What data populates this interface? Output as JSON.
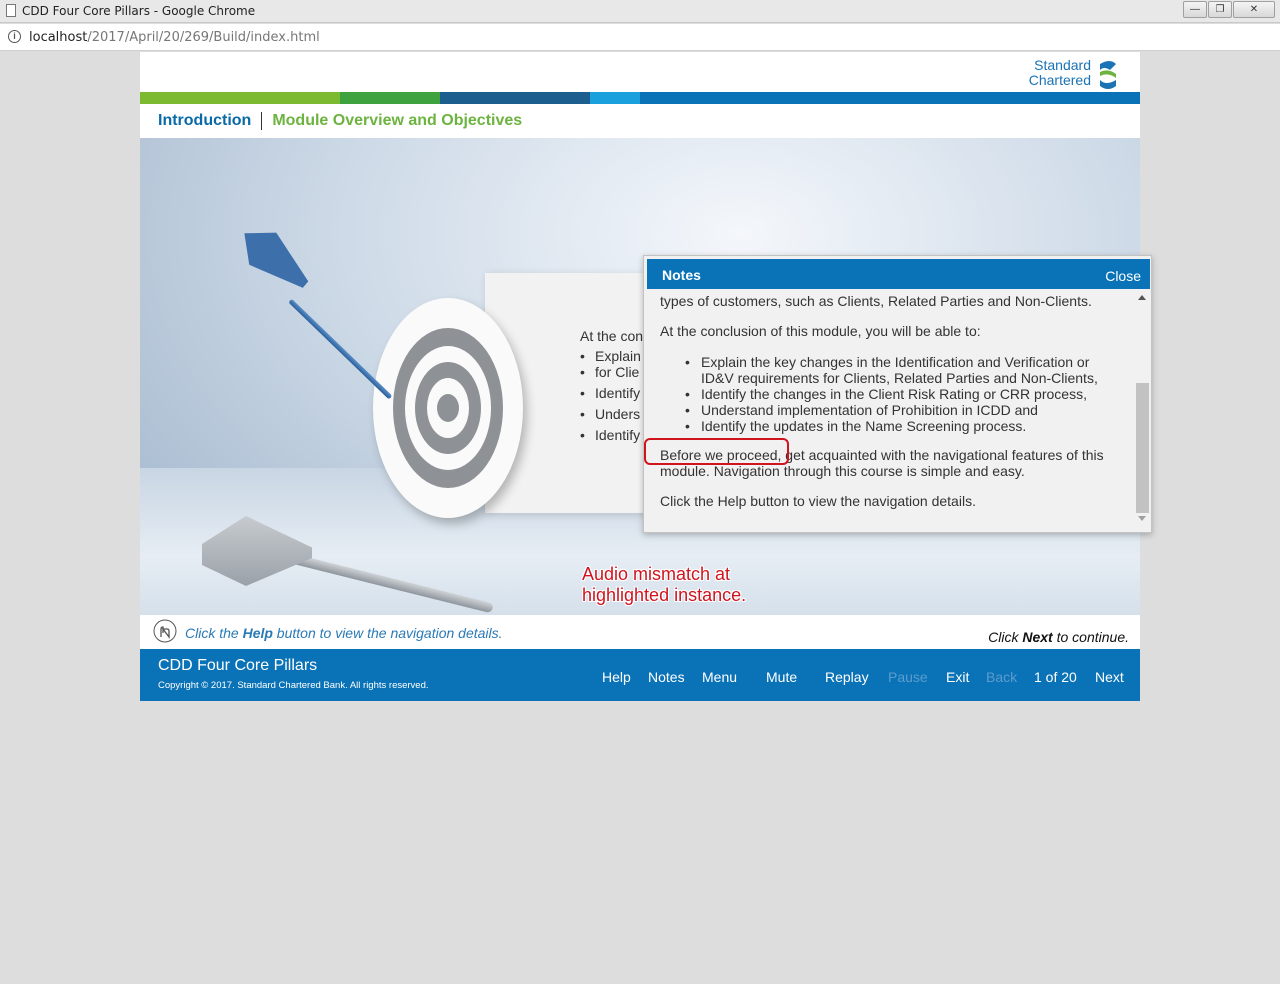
{
  "browser": {
    "window_title": "CDD Four Core Pillars - Google Chrome",
    "url_host": "localhost",
    "url_path": "/2017/April/20/269/Build/index.html",
    "controls": {
      "minimize": "—",
      "maximize": "❐",
      "close": "✕"
    }
  },
  "logo": {
    "line1": "Standard",
    "line2": "Chartered"
  },
  "colors": {
    "primary_blue": "#0a73b7",
    "green": "#6db33f",
    "light_green": "#7cbb31",
    "dark_blue": "#1c5f8f",
    "cyan": "#1aa0dc",
    "red": "#d0141e"
  },
  "breadcrumb": {
    "item1": "Introduction",
    "item2": "Module Overview and Objectives"
  },
  "stage": {
    "card_lead": "At the con",
    "card_items": [
      "Explain",
      "for Clie",
      "Identify",
      "Unders",
      "Identify"
    ]
  },
  "annotation": {
    "line1": "Audio mismatch at",
    "line2": "highlighted instance."
  },
  "hint": {
    "prefix": "Click the ",
    "help_word": "Help",
    "suffix": " button to view the navigation details.",
    "continue_prefix": "Click ",
    "continue_word": "Next",
    "continue_suffix": " to continue."
  },
  "footer": {
    "title": "CDD Four Core Pillars",
    "copyright": "Copyright © 2017. Standard Chartered Bank. All rights reserved.",
    "nav": {
      "help": "Help",
      "notes": "Notes",
      "menu": "Menu",
      "mute": "Mute",
      "replay": "Replay",
      "pause": "Pause",
      "exit": "Exit",
      "back": "Back",
      "page": "1 of 20",
      "next": "Next"
    }
  },
  "notes": {
    "title": "Notes",
    "close": "Close",
    "para0_tail": "types of customers, such as Clients, Related Parties and Non-Clients.",
    "para1": "At the conclusion of this module, you will be able to:",
    "bullets": [
      "Explain the key changes in the Identification and Verification or ID&V requirements for Clients, Related Parties and Non-Clients,",
      "Identify the changes in the Client Risk Rating or CRR process,",
      "Understand implementation of Prohibition in ICDD and",
      "Identify the updates in the Name Screening process."
    ],
    "para2": "Before we proceed, get acquainted with the navigational features of this module. Navigation through this course is simple and easy.",
    "para3": "Click the Help button to view the navigation details."
  }
}
